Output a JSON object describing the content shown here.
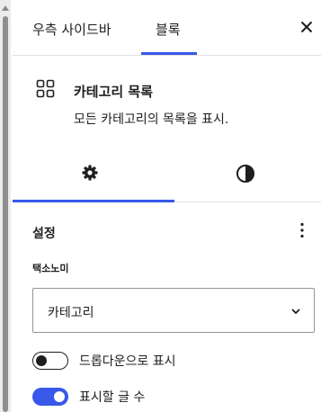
{
  "header": {
    "tabs": [
      {
        "label": "우측 사이드바"
      },
      {
        "label": "블록"
      }
    ],
    "close_icon": "close-icon"
  },
  "block": {
    "icon": "grid-icon",
    "title": "카테고리 목록",
    "description": "모든 카테고리의 목록을 표시."
  },
  "inspector_tabs": [
    {
      "icon": "gear-icon",
      "active": true
    },
    {
      "icon": "contrast-icon",
      "active": false
    }
  ],
  "settings": {
    "title": "설정",
    "taxonomy": {
      "label": "택소노미",
      "value": "카테고리"
    },
    "toggles": [
      {
        "label": "드롭다운으로 표시",
        "on": false
      },
      {
        "label": "표시할 글 수",
        "on": true
      }
    ]
  },
  "colors": {
    "accent": "#3858e9"
  }
}
